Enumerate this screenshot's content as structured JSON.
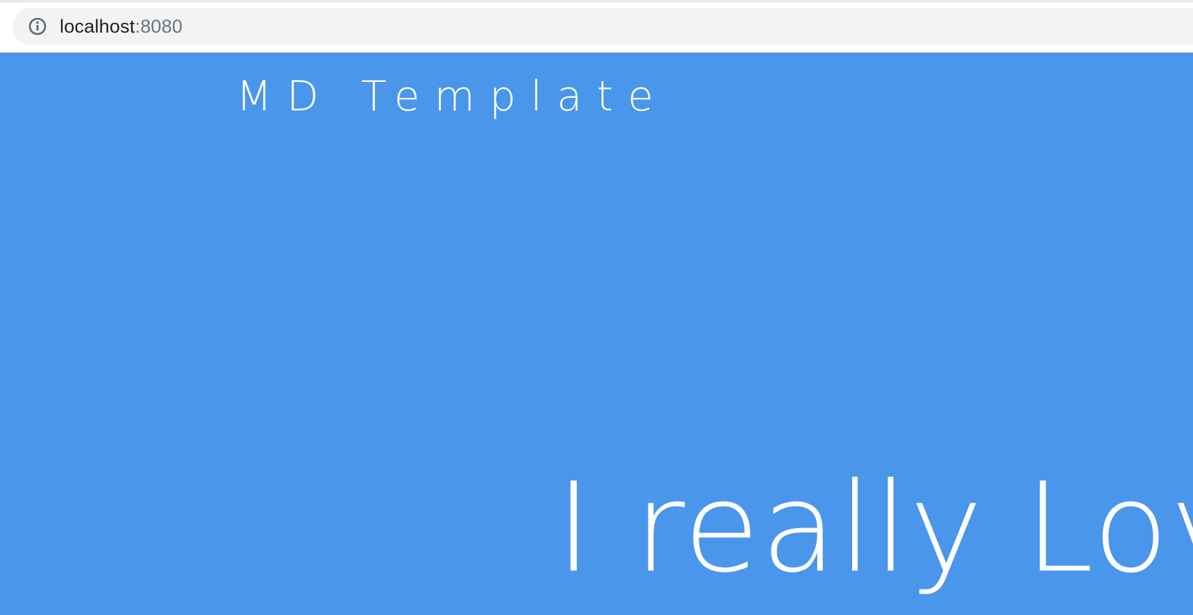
{
  "browser": {
    "url_host": "localhost",
    "url_port": ":8080",
    "info_icon": "info-icon",
    "colors": {
      "address_bar_bg": "#f1f3f4",
      "host_text": "#202124",
      "port_text": "#6f7378"
    }
  },
  "page": {
    "title": "MD Template",
    "hero": "I really Love",
    "colors": {
      "background": "#4a96ea",
      "text": "#ffffff"
    }
  }
}
